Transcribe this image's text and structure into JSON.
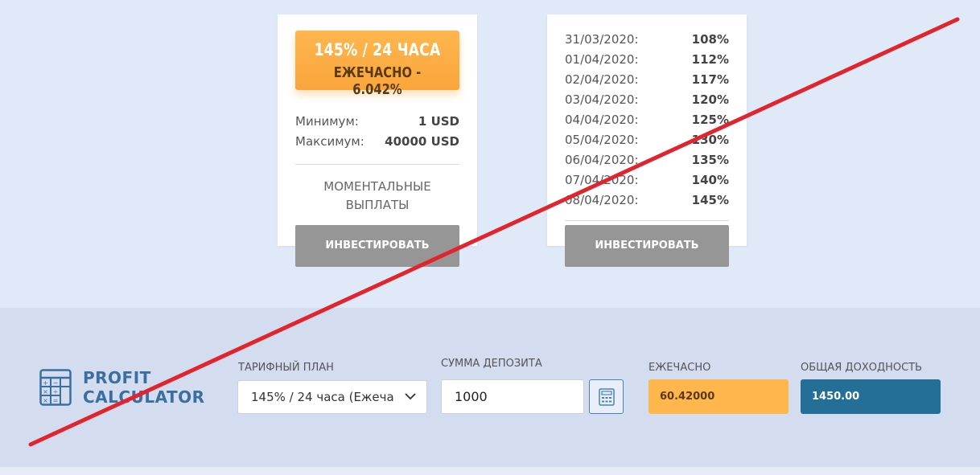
{
  "colors": {
    "page_bg": "#dfe9f8",
    "calc_bg": "#d3ddef",
    "badge_orange": "#ffb64e",
    "button_gray": "#969696",
    "accent_blue": "#236f97",
    "title_blue": "#3a6fa0",
    "cross_red": "#e0252f"
  },
  "plan_card": {
    "badge_line1": "145% / 24 ЧАСА",
    "badge_line2": "ЕЖЕЧАСНО - 6.042%",
    "min_label": "Минимум:",
    "min_value": "1 USD",
    "max_label": "Максимум:",
    "max_value": "40000 USD",
    "payout_line1": "МОМЕНТАЛЬНЫЕ",
    "payout_line2": "ВЫПЛАТЫ",
    "invest_label": "ИНВЕСТИРОВАТЬ"
  },
  "schedule_card": {
    "rows": [
      {
        "date": "31/03/2020:",
        "pct": "108%"
      },
      {
        "date": "01/04/2020:",
        "pct": "112%"
      },
      {
        "date": "02/04/2020:",
        "pct": "117%"
      },
      {
        "date": "03/04/2020:",
        "pct": "120%"
      },
      {
        "date": "04/04/2020:",
        "pct": "125%"
      },
      {
        "date": "05/04/2020:",
        "pct": "130%"
      },
      {
        "date": "06/04/2020:",
        "pct": "135%"
      },
      {
        "date": "07/04/2020:",
        "pct": "140%"
      },
      {
        "date": "08/04/2020:",
        "pct": "145%"
      }
    ],
    "invest_label": "ИНВЕСТИРОВАТЬ"
  },
  "calculator": {
    "icon": "calculator-icon",
    "title_line1": "PROFIT",
    "title_line2": "CALCULATOR",
    "plan_label": "ТАРИФНЫЙ ПЛАН",
    "plan_value": "145% / 24 часа (Ежеча",
    "deposit_label": "СУММА ДЕПОЗИТА",
    "deposit_value": "1000",
    "hourly_label": "ЕЖЕЧАСНО",
    "hourly_value": "60.42000",
    "total_label": "ОБЩАЯ ДОХОДНОСТЬ",
    "total_value": "1450.00"
  }
}
